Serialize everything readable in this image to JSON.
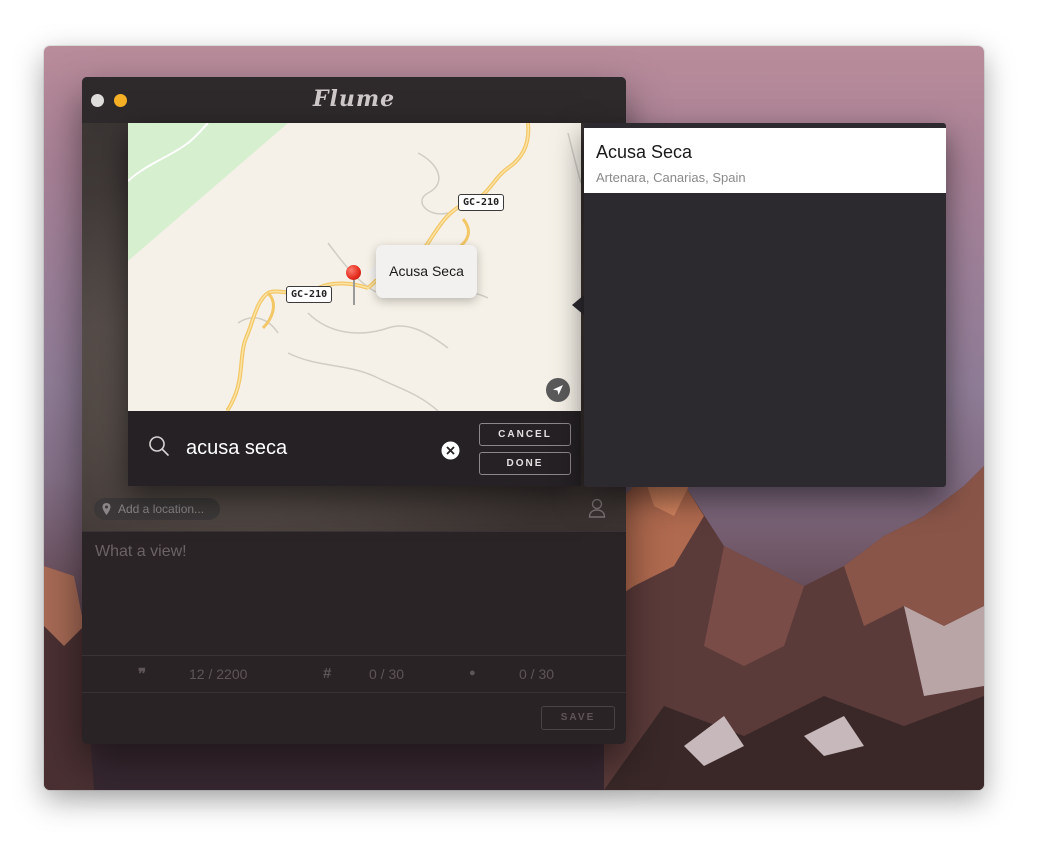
{
  "app": {
    "title": "Flume"
  },
  "composer": {
    "location_placeholder": "Add a location...",
    "caption": "What a view!",
    "counters": [
      {
        "icon": "quote-icon",
        "glyph": "❞",
        "value": "12 / 2200"
      },
      {
        "icon": "hashtag-icon",
        "glyph": "#",
        "value": "0 / 30"
      },
      {
        "icon": "user-tag-icon",
        "glyph": "●",
        "value": "0 / 30"
      }
    ],
    "save_label": "SAVE"
  },
  "picker": {
    "map": {
      "road_label_1": "GC-210",
      "road_label_2": "GC-210",
      "callout": "Acusa Seca"
    },
    "search_value": "acusa seca",
    "cancel_label": "CANCEL",
    "done_label": "DONE"
  },
  "results": [
    {
      "title": "Acusa Seca",
      "subtitle": "Artenara, Canarias, Spain"
    }
  ],
  "colors": {
    "accent_yellow": "#f6b025",
    "pin_red": "#e22a1b",
    "map_background": "#f5f1e8",
    "road_orange": "#f3c766"
  }
}
